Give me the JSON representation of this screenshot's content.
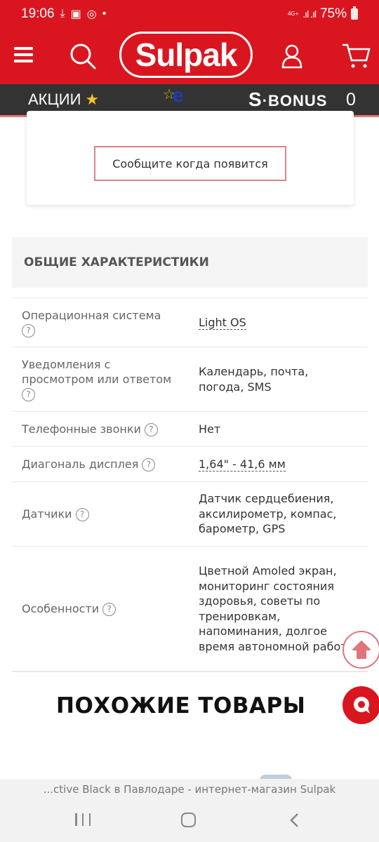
{
  "status_bar": {
    "time": "19:06",
    "notification_icons": [
      "download-icon",
      "image-icon",
      "whatsapp-icon",
      "dot-icon"
    ],
    "network": "4G+",
    "battery": "75%"
  },
  "header": {
    "logo": "Sulpak",
    "icons": [
      "menu-icon",
      "search-icon",
      "user-icon",
      "cart-icon"
    ]
  },
  "subbar": {
    "promo_label": "АКЦИИ",
    "promo_icon": "star-icon",
    "bonus_s": "S",
    "bonus_label": "BONUS",
    "bonus_count": "0"
  },
  "notify": {
    "button_label": "Сообщите когда появится"
  },
  "specs": {
    "section_title": "ОБЩИЕ ХАРАКТЕРИСТИКИ",
    "help_glyph": "?",
    "rows": [
      {
        "label": "Операционная система",
        "value": "Light OS"
      },
      {
        "label": "Уведомления с просмотром или ответом",
        "value": "Календарь, почта, погода, SMS"
      },
      {
        "label": "Телефонные звонки",
        "value": "Нет"
      },
      {
        "label": "Диагональ дисплея",
        "value": "1,64\" - 41,6 мм"
      },
      {
        "label": "Датчики",
        "value": "Датчик сердцебиения, аксилирометр, компас, барометр, GPS"
      },
      {
        "label": "Особенности",
        "value": "Цветной Amoled экран, мониторинг состояния здоровья, советы по тренировкам, напоминания, долгое время автономной работы"
      }
    ]
  },
  "similar": {
    "title": "ПОХОЖИЕ ТОВАРЫ"
  },
  "floating": {
    "scroll_top_icon": "arrow-up-icon",
    "chat_icon": "chat-icon"
  },
  "browser": {
    "page_title": "...ctive Black в Павлодаре - интернет-магазин Sulpak"
  }
}
